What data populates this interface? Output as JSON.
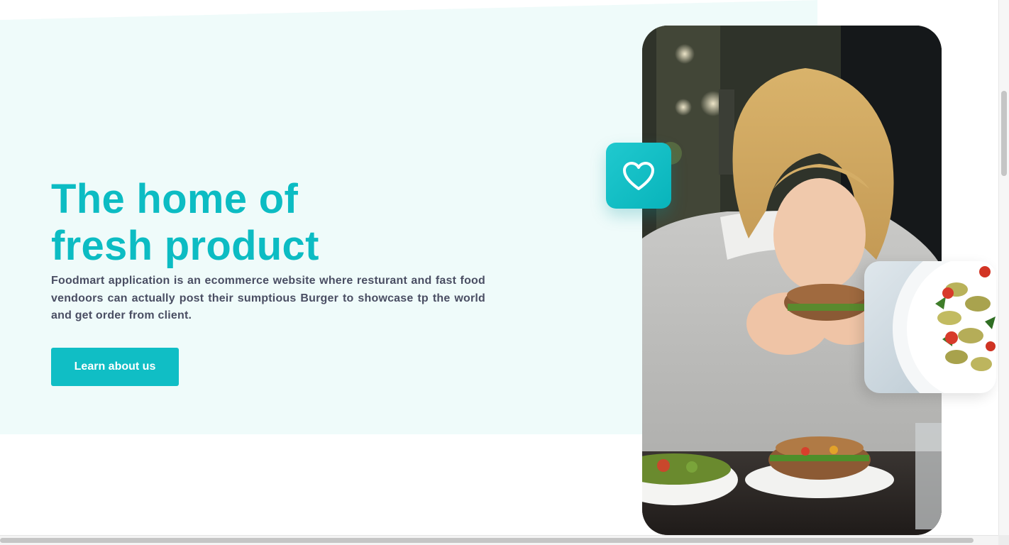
{
  "hero": {
    "title_line1": "The home of",
    "title_line2": "fresh product",
    "description": "Foodmart application is an ecommerce website where resturant and fast food vendoors can actually post their sumptious Burger to showcase tp the world and get order from client.",
    "cta_label": "Learn about us"
  },
  "media": {
    "main_photo": "woman-eating-burger-photo",
    "favorite_icon": "heart-icon",
    "thumbnail": "pasta-salad-photo"
  },
  "colors": {
    "accent": "#0cbcc3",
    "button": "#10bec5",
    "hero_background": "#effbfa",
    "body_text": "#4a4e63"
  }
}
